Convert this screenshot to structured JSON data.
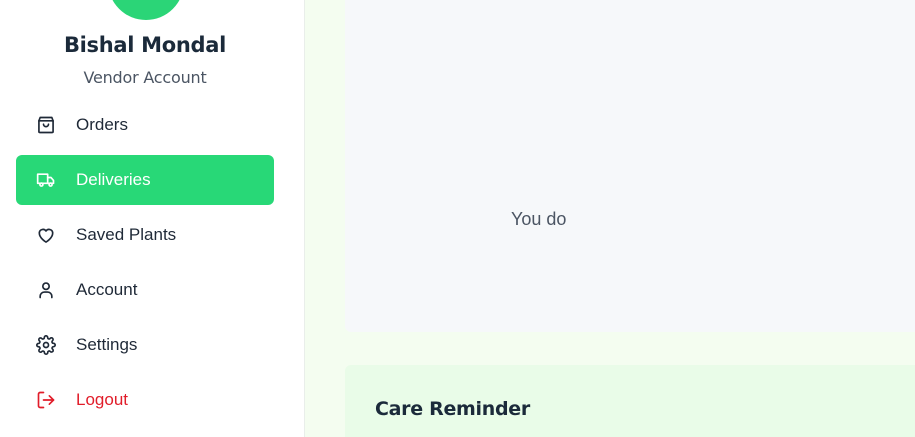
{
  "profile": {
    "name": "Bishal Mondal",
    "role": "Vendor Account",
    "avatar_color": "#2bd577"
  },
  "nav": {
    "active": "Deliveries",
    "items": [
      {
        "label": "Orders",
        "icon": "shopping-bag-icon"
      },
      {
        "label": "Deliveries",
        "icon": "truck-icon"
      },
      {
        "label": "Saved Plants",
        "icon": "heart-icon"
      },
      {
        "label": "Account",
        "icon": "user-icon"
      },
      {
        "label": "Settings",
        "icon": "gear-icon"
      },
      {
        "label": "Logout",
        "icon": "logout-icon"
      }
    ]
  },
  "main": {
    "empty_message": "You do",
    "care_reminder_title": "Care Reminder"
  },
  "colors": {
    "accent": "#28d877",
    "logout": "#e11d2a",
    "page_bg": "#f4fdf0",
    "card_bg": "#e9fce8"
  }
}
